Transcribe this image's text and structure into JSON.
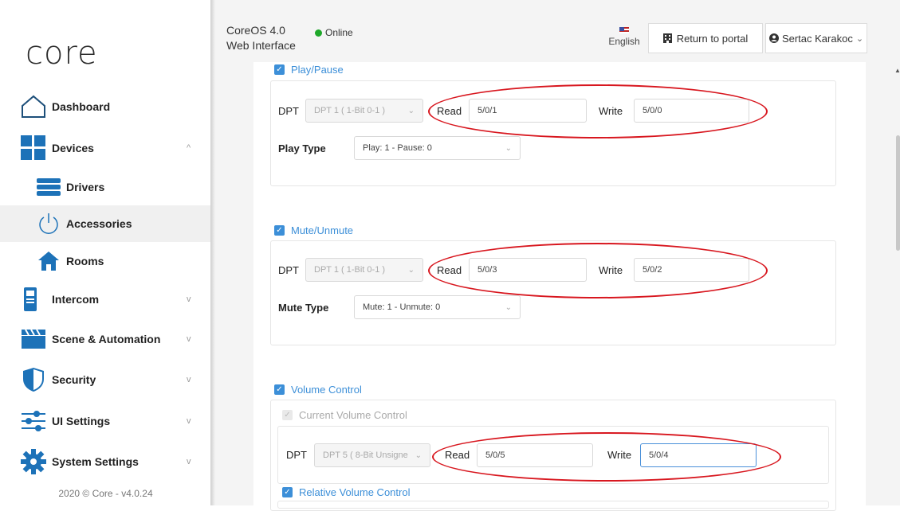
{
  "sidebar": {
    "logo": "core",
    "items": [
      {
        "label": "Dashboard",
        "icon": "house-icon"
      },
      {
        "label": "Devices",
        "icon": "grid-icon"
      },
      {
        "label": "Drivers",
        "icon": "server-icon"
      },
      {
        "label": "Accessories",
        "icon": "power-icon"
      },
      {
        "label": "Rooms",
        "icon": "home-icon"
      },
      {
        "label": "Intercom",
        "icon": "intercom-icon"
      },
      {
        "label": "Scene & Automation",
        "icon": "clapperboard-icon"
      },
      {
        "label": "Security",
        "icon": "shield-icon"
      },
      {
        "label": "UI Settings",
        "icon": "sliders-icon"
      },
      {
        "label": "System Settings",
        "icon": "gear-icon"
      }
    ],
    "footer": "2020 © Core - v4.0.24"
  },
  "header": {
    "title_line1": "CoreOS 4.0",
    "title_line2": "Web Interface",
    "status": "Online",
    "language": "English",
    "return_portal": "Return to portal",
    "user": "Sertac Karakoc"
  },
  "sections": {
    "play": {
      "title": "Play/Pause",
      "dpt_label": "DPT",
      "dpt_value": "DPT 1 ( 1-Bit 0-1 )",
      "read_label": "Read",
      "read_value": "5/0/1",
      "write_label": "Write",
      "write_value": "5/0/0",
      "type_label": "Play Type",
      "type_value": "Play: 1 - Pause: 0"
    },
    "mute": {
      "title": "Mute/Unmute",
      "dpt_label": "DPT",
      "dpt_value": "DPT 1 ( 1-Bit 0-1 )",
      "read_label": "Read",
      "read_value": "5/0/3",
      "write_label": "Write",
      "write_value": "5/0/2",
      "type_label": "Mute Type",
      "type_value": "Mute: 1 - Unmute: 0"
    },
    "volume": {
      "title": "Volume Control",
      "current_label": "Current Volume Control",
      "dpt_label": "DPT",
      "dpt_value": "DPT 5 ( 8-Bit Unsigne",
      "read_label": "Read",
      "read_value": "5/0/5",
      "write_label": "Write",
      "write_value": "5/0/4",
      "relative_label": "Relative Volume Control"
    }
  },
  "colors": {
    "accent": "#3c8fd8",
    "annotation": "#d8171f",
    "online": "#1fa82a"
  }
}
